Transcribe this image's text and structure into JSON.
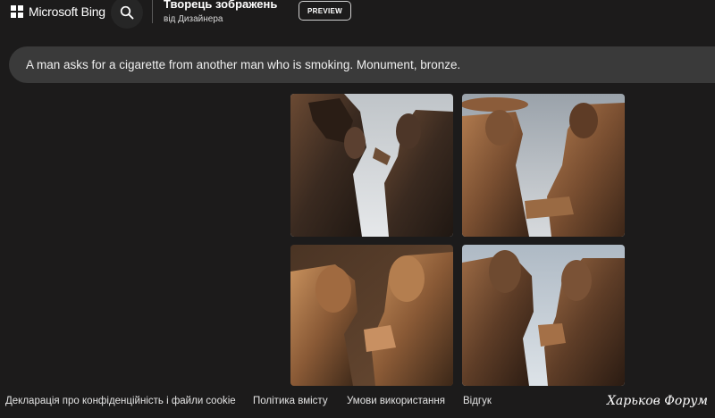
{
  "header": {
    "brand": "Microsoft Bing",
    "title": "Творець зображень",
    "subtitle": "від Дизайнера",
    "preview_label": "PREVIEW"
  },
  "prompt": {
    "text": "A man asks for a cigarette from another man who is smoking. Monument, bronze."
  },
  "images": [
    {
      "icon": "bronze-statue-image"
    },
    {
      "icon": "bronze-statue-image"
    },
    {
      "icon": "bronze-statue-image"
    },
    {
      "icon": "bronze-statue-image"
    }
  ],
  "footer": {
    "privacy": "Декларація про конфіденційність і файли cookie",
    "content_policy": "Політика вмісту",
    "terms": "Умови використання",
    "feedback": "Відгук",
    "watermark": "Харьков Форум"
  },
  "colors": {
    "background": "#1c1b1b",
    "prompt_bar": "#3a3a3a",
    "bronze": "#8a5a36"
  }
}
